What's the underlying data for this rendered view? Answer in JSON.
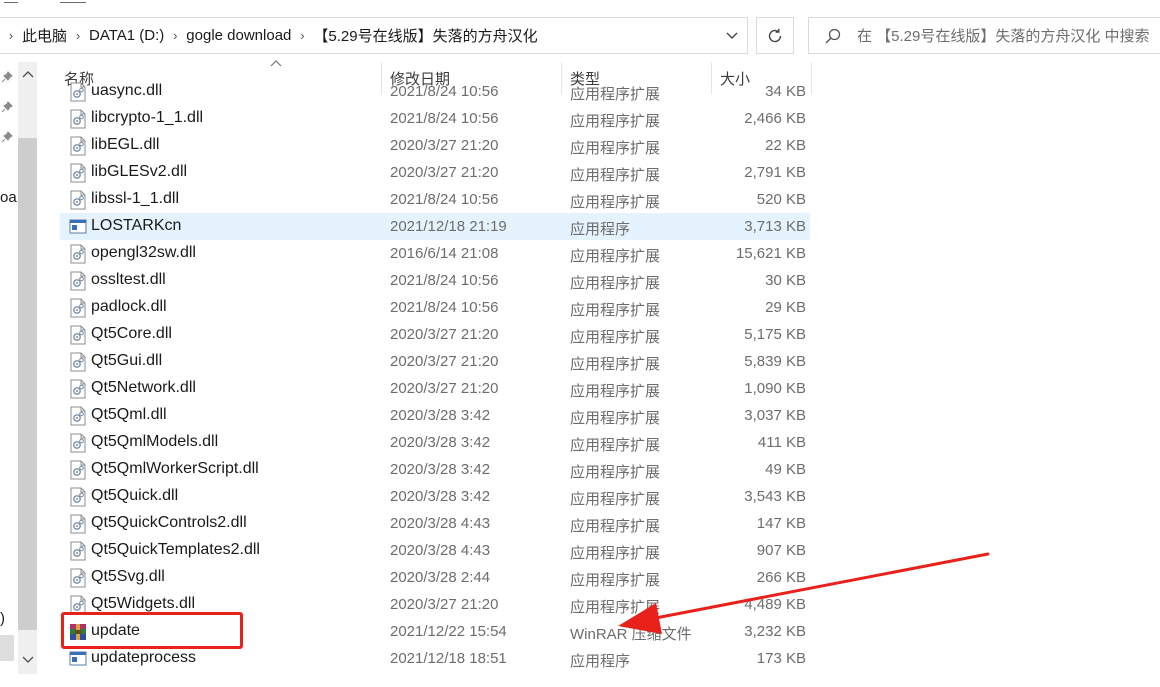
{
  "breadcrumb": {
    "items": [
      "此电脑",
      "DATA1 (D:)",
      "gogle download",
      "【5.29号在线版】失落的方舟汉化"
    ]
  },
  "search": {
    "placeholder": "在 【5.29号在线版】失落的方舟汉化 中搜索"
  },
  "nav": {
    "clipped_text": "oa",
    "clipped_paren": ")"
  },
  "columns": {
    "name": "名称",
    "date": "修改日期",
    "type": "类型",
    "size": "大小"
  },
  "files": [
    {
      "name": "uasync.dll",
      "date": "2021/8/24 10:56",
      "type": "应用程序扩展",
      "size": "34 KB",
      "icon": "dll-icon"
    },
    {
      "name": "libcrypto-1_1.dll",
      "date": "2021/8/24 10:56",
      "type": "应用程序扩展",
      "size": "2,466 KB",
      "icon": "dll-icon"
    },
    {
      "name": "libEGL.dll",
      "date": "2020/3/27 21:20",
      "type": "应用程序扩展",
      "size": "22 KB",
      "icon": "dll-icon"
    },
    {
      "name": "libGLESv2.dll",
      "date": "2020/3/27 21:20",
      "type": "应用程序扩展",
      "size": "2,791 KB",
      "icon": "dll-icon"
    },
    {
      "name": "libssl-1_1.dll",
      "date": "2021/8/24 10:56",
      "type": "应用程序扩展",
      "size": "520 KB",
      "icon": "dll-icon"
    },
    {
      "name": "LOSTARKcn",
      "date": "2021/12/18 21:19",
      "type": "应用程序",
      "size": "3,713 KB",
      "icon": "exe-icon",
      "selected": true
    },
    {
      "name": "opengl32sw.dll",
      "date": "2016/6/14 21:08",
      "type": "应用程序扩展",
      "size": "15,621 KB",
      "icon": "dll-icon"
    },
    {
      "name": "ossltest.dll",
      "date": "2021/8/24 10:56",
      "type": "应用程序扩展",
      "size": "30 KB",
      "icon": "dll-icon"
    },
    {
      "name": "padlock.dll",
      "date": "2021/8/24 10:56",
      "type": "应用程序扩展",
      "size": "29 KB",
      "icon": "dll-icon"
    },
    {
      "name": "Qt5Core.dll",
      "date": "2020/3/27 21:20",
      "type": "应用程序扩展",
      "size": "5,175 KB",
      "icon": "dll-icon"
    },
    {
      "name": "Qt5Gui.dll",
      "date": "2020/3/27 21:20",
      "type": "应用程序扩展",
      "size": "5,839 KB",
      "icon": "dll-icon"
    },
    {
      "name": "Qt5Network.dll",
      "date": "2020/3/27 21:20",
      "type": "应用程序扩展",
      "size": "1,090 KB",
      "icon": "dll-icon"
    },
    {
      "name": "Qt5Qml.dll",
      "date": "2020/3/28 3:42",
      "type": "应用程序扩展",
      "size": "3,037 KB",
      "icon": "dll-icon"
    },
    {
      "name": "Qt5QmlModels.dll",
      "date": "2020/3/28 3:42",
      "type": "应用程序扩展",
      "size": "411 KB",
      "icon": "dll-icon"
    },
    {
      "name": "Qt5QmlWorkerScript.dll",
      "date": "2020/3/28 3:42",
      "type": "应用程序扩展",
      "size": "49 KB",
      "icon": "dll-icon"
    },
    {
      "name": "Qt5Quick.dll",
      "date": "2020/3/28 3:42",
      "type": "应用程序扩展",
      "size": "3,543 KB",
      "icon": "dll-icon"
    },
    {
      "name": "Qt5QuickControls2.dll",
      "date": "2020/3/28 4:43",
      "type": "应用程序扩展",
      "size": "147 KB",
      "icon": "dll-icon"
    },
    {
      "name": "Qt5QuickTemplates2.dll",
      "date": "2020/3/28 4:43",
      "type": "应用程序扩展",
      "size": "907 KB",
      "icon": "dll-icon"
    },
    {
      "name": "Qt5Svg.dll",
      "date": "2020/3/28 2:44",
      "type": "应用程序扩展",
      "size": "266 KB",
      "icon": "dll-icon"
    },
    {
      "name": "Qt5Widgets.dll",
      "date": "2020/3/27 21:20",
      "type": "应用程序扩展",
      "size": "4,489 KB",
      "icon": "dll-icon"
    },
    {
      "name": "update",
      "date": "2021/12/22 15:54",
      "type": "WinRAR 压缩文件",
      "size": "3,232 KB",
      "icon": "winrar-archive-icon"
    },
    {
      "name": "updateprocess",
      "date": "2021/12/18 18:51",
      "type": "应用程序",
      "size": "173 KB",
      "icon": "exe-icon"
    }
  ],
  "annotation": {
    "highlight_color": "#e8221b",
    "arrow_color": "#e8221b"
  },
  "colors": {
    "selection": "#e5f3ff",
    "secondary_text": "#6d6d6d"
  }
}
